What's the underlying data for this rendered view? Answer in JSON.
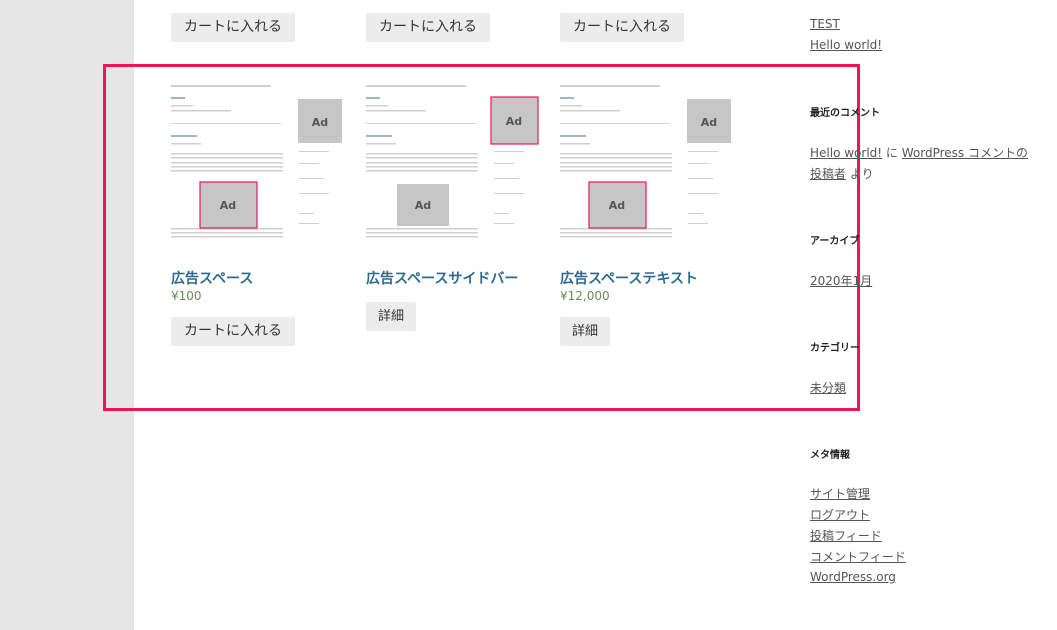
{
  "top_buttons": [
    "カートに入れる",
    "カートに入れる",
    "カートに入れる"
  ],
  "products": [
    {
      "title": "広告スペース",
      "price": "¥100",
      "button": "カートに入れる"
    },
    {
      "title": "広告スペースサイドバー",
      "price": "",
      "button": "詳細"
    },
    {
      "title": "広告スペーステキスト",
      "price": "¥12,000",
      "button": "詳細"
    }
  ],
  "ad_label": "Ad",
  "sidebar": {
    "recent_posts": [
      "TEST",
      "Hello world!"
    ],
    "recent_comments_heading": "最近のコメント",
    "comment": {
      "author_link": "Hello world!",
      "connector": " に ",
      "post_link": "WordPress コメントの投稿者",
      "suffix": " より"
    },
    "archives_heading": "アーカイブ",
    "archive_item": "2020年1月",
    "categories_heading": "カテゴリー",
    "category_item": "未分類",
    "meta_heading": "メタ情報",
    "meta_links": [
      "サイト管理",
      "ログアウト",
      "投稿フィード",
      "コメントフィード",
      "WordPress.org"
    ]
  },
  "colors": {
    "highlight": "#e8185a",
    "title": "#2c6b8f",
    "button_bg": "#ececec",
    "gutter": "#e6e6e6"
  }
}
